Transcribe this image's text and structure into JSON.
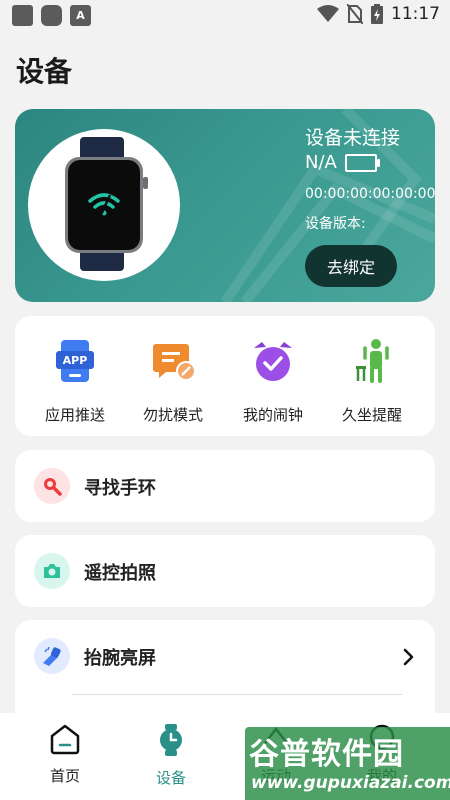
{
  "status_bar": {
    "time": "11:17",
    "notification_letter": "A"
  },
  "page": {
    "title": "设备"
  },
  "device": {
    "connection_status": "设备未连接",
    "battery_text": "N/A",
    "mac": "00:00:00:00:00:00",
    "version_label": "设备版本:",
    "unbind_label": "去绑定"
  },
  "quick_actions": [
    {
      "label": "应用推送",
      "icon": "app-push-icon",
      "icon_text": "APP"
    },
    {
      "label": "勿扰模式",
      "icon": "do-not-disturb-icon"
    },
    {
      "label": "我的闹钟",
      "icon": "alarm-clock-icon"
    },
    {
      "label": "久坐提醒",
      "icon": "sedentary-reminder-icon"
    }
  ],
  "rows": [
    {
      "label": "寻找手环",
      "icon": "search-icon"
    },
    {
      "label": "遥控拍照",
      "icon": "camera-icon"
    },
    {
      "label": "抬腕亮屏",
      "icon": "raise-wrist-icon"
    }
  ],
  "tabs": [
    {
      "label": "首页",
      "icon": "home-icon",
      "active": false
    },
    {
      "label": "设备",
      "icon": "watch-icon",
      "active": true
    },
    {
      "label": "运动",
      "icon": "sport-icon",
      "active": false
    },
    {
      "label": "我的",
      "icon": "profile-icon",
      "active": false
    }
  ],
  "watermark": {
    "title": "谷普软件园",
    "url": "www.gupuxiazai.com"
  },
  "colors": {
    "accent": "#2a8f89",
    "card_gradient_start": "#2c8680",
    "card_gradient_end": "#4aa79c"
  }
}
